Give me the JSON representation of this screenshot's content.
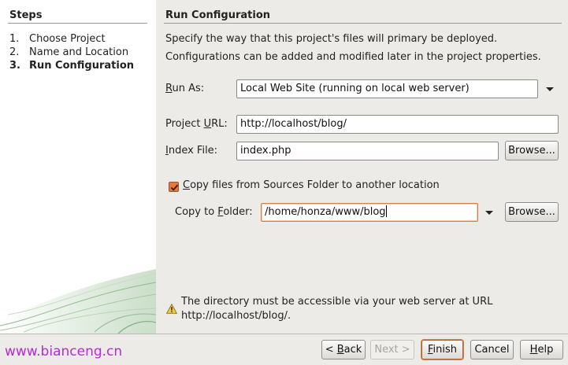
{
  "steps": {
    "title": "Steps",
    "items": [
      {
        "num": "1.",
        "label": "Choose Project"
      },
      {
        "num": "2.",
        "label": "Name and Location"
      },
      {
        "num": "3.",
        "label": "Run Configuration"
      }
    ]
  },
  "panel": {
    "title": "Run Configuration",
    "description_line1": "Specify the way that this project's files will primary be deployed.",
    "description_line2": "Configurations can be added and modified later in the project properties."
  },
  "form": {
    "run_as": {
      "label_pre": "",
      "label_mnemonic": "R",
      "label_post": "un As:",
      "value": "Local Web Site (running on local web server)"
    },
    "project_url": {
      "label_pre": "Project ",
      "label_mnemonic": "U",
      "label_post": "RL:",
      "value": "http://localhost/blog/"
    },
    "index_file": {
      "label_pre": "",
      "label_mnemonic": "I",
      "label_post": "ndex File:",
      "value": "index.php",
      "browse_label": "Browse..."
    },
    "copy_files": {
      "checked": true,
      "label_pre": "",
      "label_mnemonic": "C",
      "label_post": "opy files from Sources Folder to another location"
    },
    "copy_to_folder": {
      "label_pre": "Copy to ",
      "label_mnemonic": "F",
      "label_post": "older:",
      "value": "/home/honza/www/blog",
      "browse_label": "Browse..."
    }
  },
  "warning": {
    "icon": "warning-icon",
    "line1": "The directory must be accessible via your web server at URL",
    "line2": "http://localhost/blog/."
  },
  "buttons": {
    "back_mnemonic": "B",
    "back_pre": "< ",
    "back_post": "ack",
    "next": "Next >",
    "finish_mnemonic": "F",
    "finish_post": "inish",
    "cancel": "Cancel",
    "help_mnemonic": "H",
    "help_post": "elp"
  },
  "watermark": "www.bianceng.cn",
  "colors": {
    "accent": "#e5773a",
    "watermark": "#b52ad6"
  }
}
